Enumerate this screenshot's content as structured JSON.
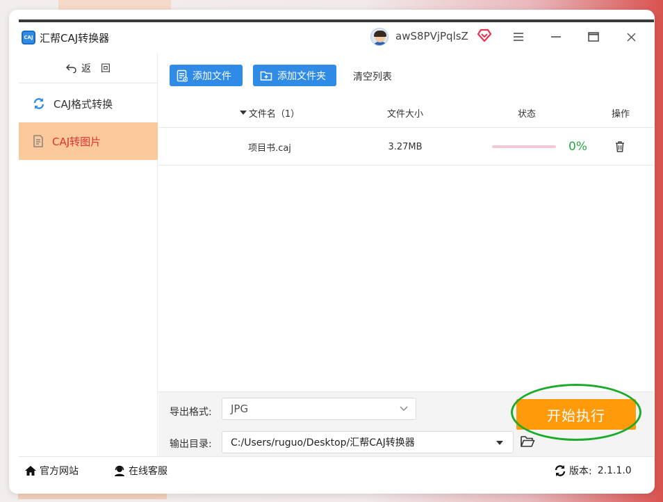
{
  "app": {
    "title": "汇帮CAJ转换器",
    "icon_text": "CAJ",
    "username": "awS8PVjPqlsZ"
  },
  "sidebar": {
    "back_label": "返　回",
    "items": [
      {
        "label": "CAJ格式转换",
        "icon": "refresh-icon",
        "active": false
      },
      {
        "label": "CAJ转图片",
        "icon": "document-icon",
        "active": true
      }
    ]
  },
  "toolbar": {
    "add_file_label": "添加文件",
    "add_folder_label": "添加文件夹",
    "clear_label": "清空列表"
  },
  "table": {
    "columns": {
      "name": "文件名（1）",
      "size": "文件大小",
      "status": "状态",
      "op": "操作"
    },
    "rows": [
      {
        "name": "项目书.caj",
        "size": "3.27MB",
        "progress_text": "0%",
        "progress": 0
      }
    ]
  },
  "output": {
    "format_label": "导出格式:",
    "format_value": "JPG",
    "dir_label": "输出目录:",
    "dir_value": "C:/Users/ruguo/Desktop/汇帮CAJ转换器",
    "start_label": "开始执行"
  },
  "statusbar": {
    "site_label": "官方网站",
    "support_label": "在线客服",
    "version_label": "版本:",
    "version_value": "2.1.1.0"
  },
  "colors": {
    "accent_blue": "#2f8be6",
    "active_bg": "#fbc99b",
    "active_text": "#e33030",
    "start_orange": "#ff9a0a",
    "progress_green": "#27a844",
    "highlight_ring": "#1eaa2b"
  }
}
